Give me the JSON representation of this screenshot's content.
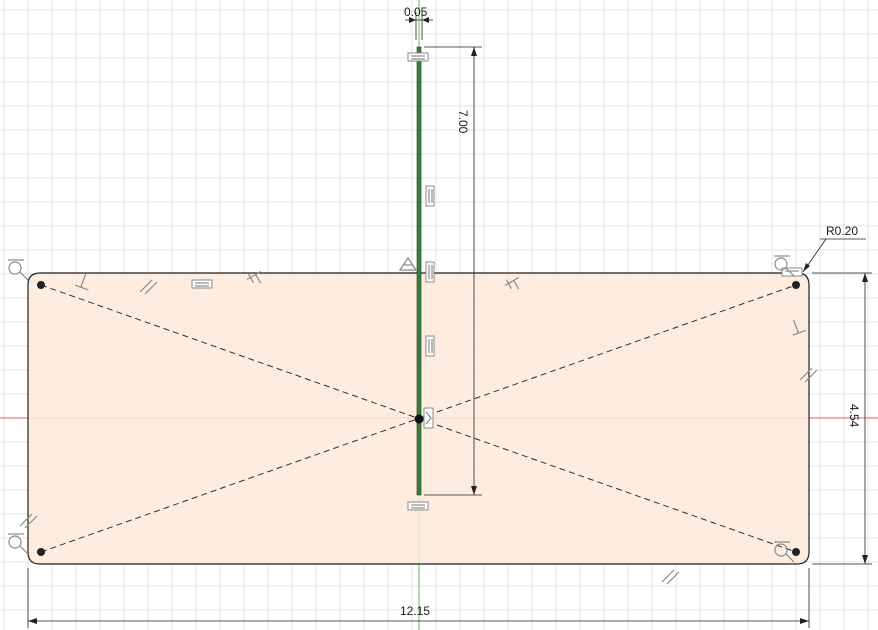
{
  "sketch": {
    "dimensions": {
      "slot_width": "0.05",
      "slot_length": "7.00",
      "plate_height": "4.54",
      "plate_width": "12.15",
      "corner_radius": "R0.20"
    },
    "colors": {
      "background": "#ffffff",
      "grid_line": "#e3e3e3",
      "profile_fill": "#fbeadb",
      "profile_line": "#202020",
      "x_axis": "#e06060",
      "y_axis": "#60c060",
      "slot_fill": "#3f7d3f",
      "construction_line": "#303030"
    },
    "constraint_icons": [
      "perpendicular-icon",
      "parallel-icon",
      "horizontal-icon",
      "tangent-icon",
      "fix-icon",
      "midpoint-icon",
      "coincident-icon"
    ]
  }
}
